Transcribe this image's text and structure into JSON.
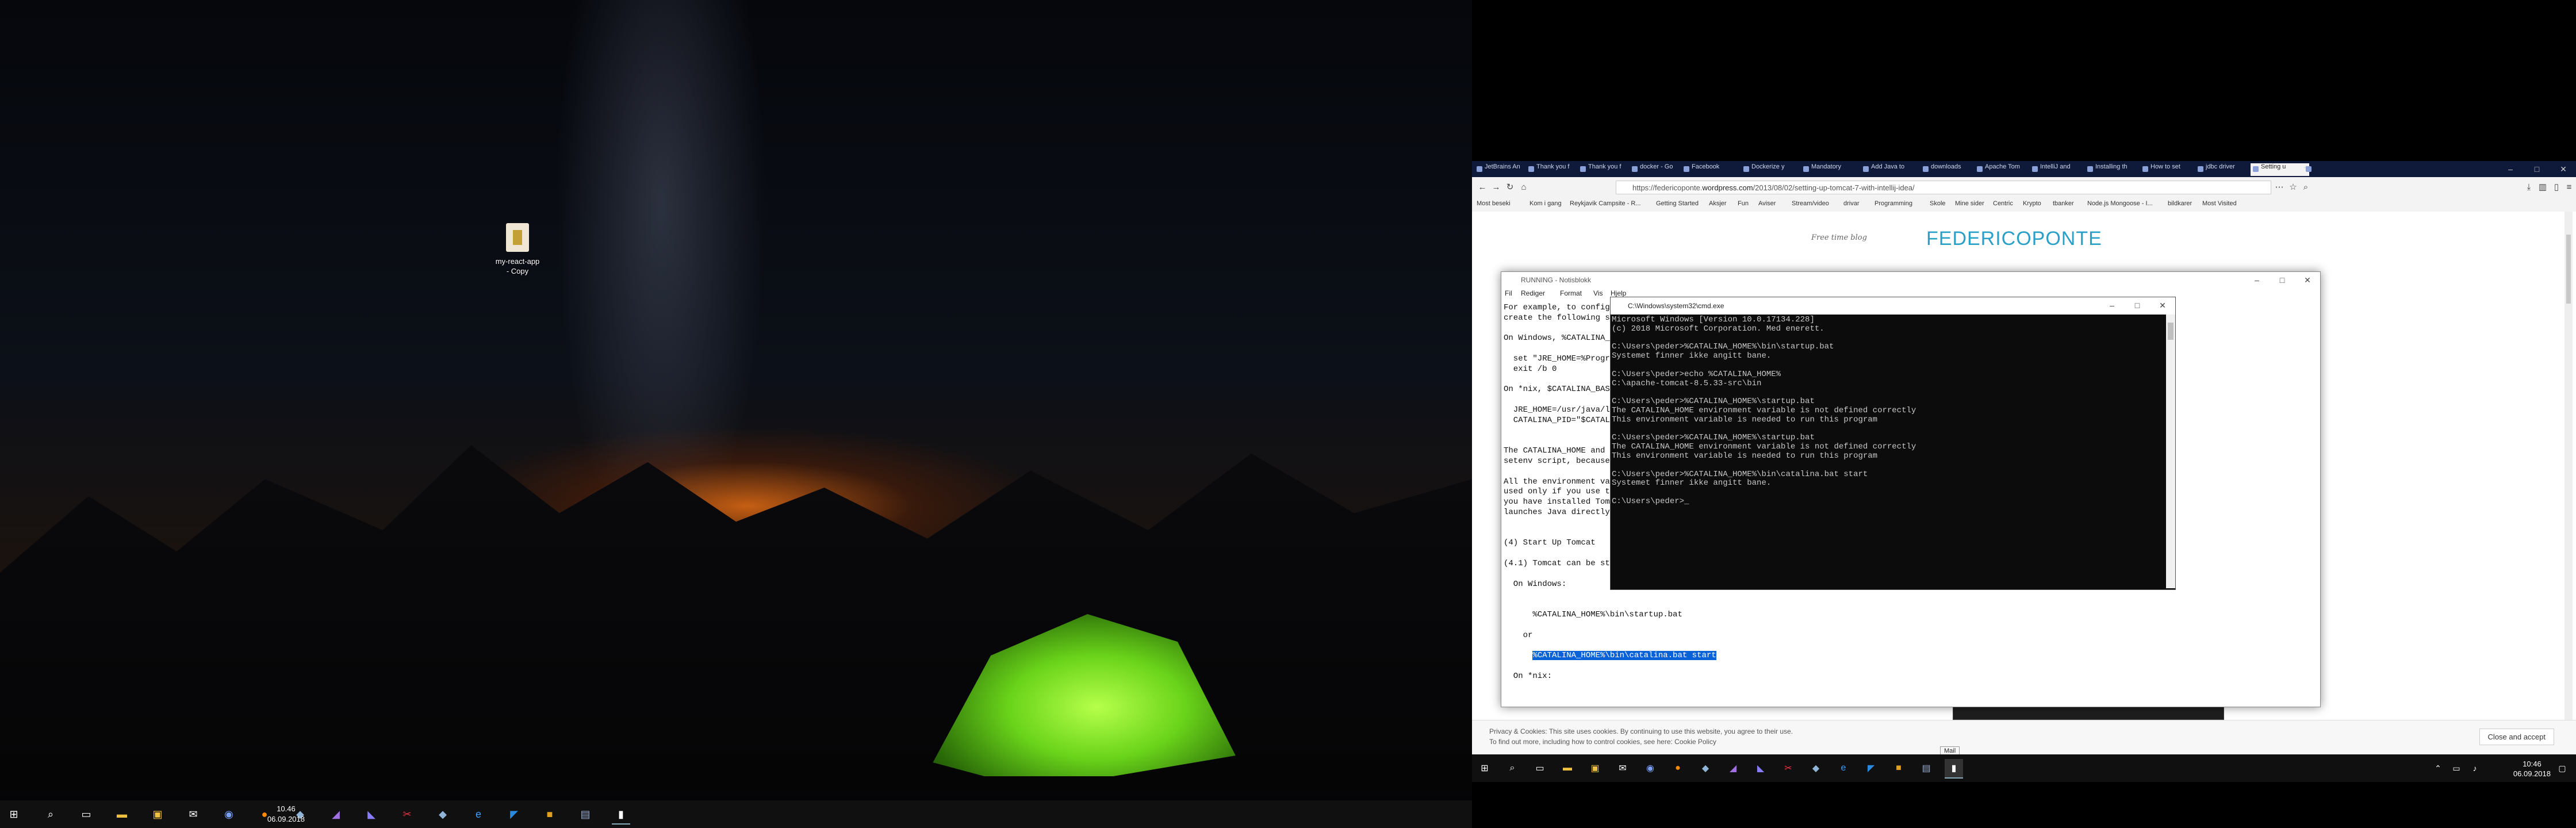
{
  "left_desktop": {
    "icon_label": "my-react-app\n- Copy",
    "clock": {
      "time": "10.46",
      "date": "06.09.2018"
    }
  },
  "firefox": {
    "tabs": [
      "JetBrains An",
      "Thank you f",
      "Thank you f",
      "docker - Go",
      "Facebook",
      "Dockerize y",
      "Mandatory",
      "Add Java to",
      "downloads",
      "Apache Tom",
      "IntelliJ and",
      "Installing th",
      "How to set",
      "jdbc driver",
      "Setting u"
    ],
    "url_prefix": "https://federicoponte.",
    "url_domain": "wordpress.com",
    "url_path": "/2013/08/02/setting-up-tomcat-7-with-intellij-idea/",
    "bookmarks": [
      "Most beseki",
      "Kom i gang",
      "Reykjavik Campsite - R...",
      "Getting Started",
      "Aksjer",
      "Fun",
      "Aviser",
      "Stream/video",
      "drivar",
      "Programming",
      "Skole",
      "Mine sider",
      "Centric",
      "Krypto",
      "tbanker",
      "Node.js Mongoose - I...",
      "bildkarer",
      "Most Visited"
    ],
    "site_tagline": "Free time blog",
    "site_name": "FEDERICOPONTE",
    "cookie_line1": "Privacy & Cookies: This site uses cookies. By continuing to use this website, you agree to their use.",
    "cookie_line2": "To find out more, including how to control cookies, see here: Cookie Policy",
    "cookie_button": "Close and accept",
    "tooltip": "Mail"
  },
  "notepad": {
    "title": "RUNNING - Notisblokk",
    "menu": [
      "Fil",
      "Rediger",
      "Format",
      "Vis",
      "Hjelp"
    ],
    "lines": [
      "For example, to configu",
      "create the following sc",
      "",
      "On Windows, %CATALINA_B",
      "",
      "  set \"JRE_HOME=%Progra",
      "  exit /b 0",
      "",
      "On *nix, $CATALINA_BASE",
      "",
      "  JRE_HOME=/usr/java/la",
      "  CATALINA_PID=\"$CATALI",
      "",
      "",
      "The CATALINA_HOME and C",
      "setenv script, because",
      "",
      "All the environment var",
      "used only if you use th",
      "you have installed Tomc",
      "launches Java directly",
      "",
      "",
      "(4) Start Up Tomcat",
      "",
      "(4.1) Tomcat can be sta",
      "",
      "  On Windows:",
      "",
      "",
      "      %CATALINA_HOME%\\bin\\startup.bat",
      "",
      "    or",
      "",
      "      %CATALINA_HOME%\\bin\\catalina.bat start",
      "",
      "  On *nix:"
    ],
    "highlight_line": 34
  },
  "cmd": {
    "title": "C:\\Windows\\system32\\cmd.exe",
    "lines": [
      "Microsoft Windows [Version 10.0.17134.228]",
      "(c) 2018 Microsoft Corporation. Med enerett.",
      "",
      "C:\\Users\\peder>%CATALINA_HOME%\\bin\\startup.bat",
      "Systemet finner ikke angitt bane.",
      "",
      "C:\\Users\\peder>echo %CATALINA_HOME%",
      "C:\\apache-tomcat-8.5.33-src\\bin",
      "",
      "C:\\Users\\peder>%CATALINA_HOME%\\startup.bat",
      "The CATALINA_HOME environment variable is not defined correctly",
      "This environment variable is needed to run this program",
      "",
      "C:\\Users\\peder>%CATALINA_HOME%\\startup.bat",
      "The CATALINA_HOME environment variable is not defined correctly",
      "This environment variable is needed to run this program",
      "",
      "C:\\Users\\peder>%CATALINA_HOME%\\bin\\catalina.bat start",
      "Systemet finner ikke angitt bane.",
      "",
      "C:\\Users\\peder>_"
    ]
  },
  "right_taskbar": {
    "clock": {
      "time": "10:46",
      "date": "06.09.2018"
    }
  },
  "colors": {
    "site_name": "#2aa0c8",
    "tab_strip": "#0f1a3a",
    "selection": "#0a62d9"
  }
}
